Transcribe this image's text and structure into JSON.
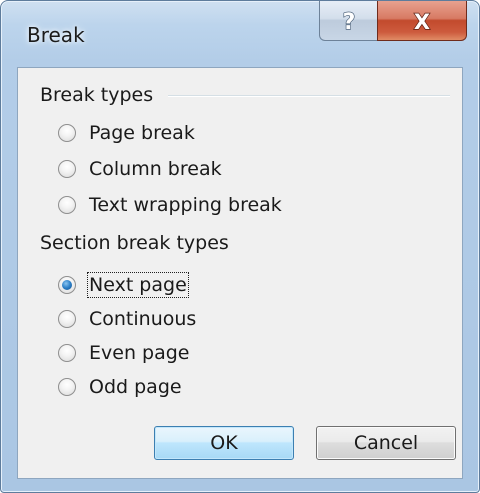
{
  "window": {
    "title": "Break",
    "help_glyph": "?",
    "close_glyph": "X"
  },
  "break_types": {
    "label": "Break types",
    "options": [
      {
        "label": "Page break",
        "checked": false
      },
      {
        "label": "Column break",
        "checked": false
      },
      {
        "label": "Text wrapping break",
        "checked": false
      }
    ]
  },
  "section_break_types": {
    "label": "Section break types",
    "options": [
      {
        "label": "Next page",
        "checked": true
      },
      {
        "label": "Continuous",
        "checked": false
      },
      {
        "label": "Even page",
        "checked": false
      },
      {
        "label": "Odd page",
        "checked": false
      }
    ]
  },
  "buttons": {
    "ok_label": "OK",
    "cancel_label": "Cancel"
  },
  "colors": {
    "title_bar": "#bcd4ec",
    "close_button": "#c24a2d",
    "dialog_face": "#f0f0f0",
    "radio_checked": "#2c7fc7"
  },
  "icons": {
    "help": "help-icon",
    "close": "close-icon"
  }
}
